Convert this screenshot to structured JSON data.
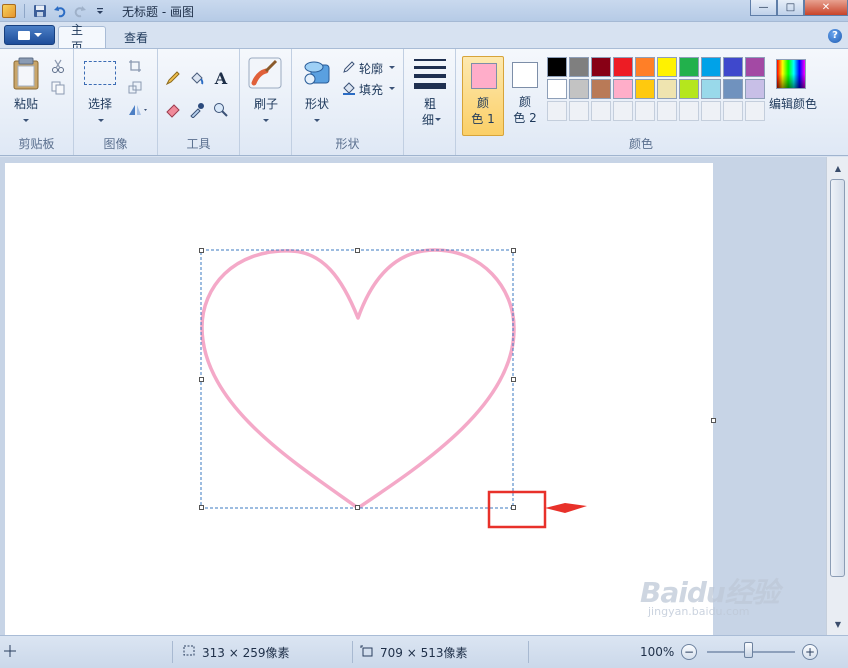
{
  "window": {
    "title": "无标题 - 画图",
    "controls": {
      "minimize": "—",
      "maximize": "□",
      "close": "✕"
    }
  },
  "tabs": [
    {
      "label": "主页",
      "active": true
    },
    {
      "label": "查看",
      "active": false
    }
  ],
  "groups": {
    "clipboard": {
      "label": "剪贴板",
      "paste": "粘贴"
    },
    "image": {
      "label": "图像",
      "select": "选择"
    },
    "tools": {
      "label": "工具",
      "text_tool": "A"
    },
    "brushes": {
      "label": "",
      "brush": "刷子"
    },
    "shapes": {
      "label": "形状",
      "shapes_btn": "形状",
      "outline": "轮廓",
      "fill": "填充"
    },
    "size": {
      "line1": "粗",
      "line2": "细"
    },
    "colors": {
      "label": "颜色",
      "color1": {
        "line1": "颜",
        "line2": "色 1",
        "value": "#ffadc9"
      },
      "color2": {
        "line1": "颜",
        "line2": "色 2",
        "value": "#ffffff"
      },
      "edit": "编辑颜色"
    }
  },
  "palette": [
    "#000000",
    "#7f7f7f",
    "#880015",
    "#ed1c24",
    "#ff7f27",
    "#fff200",
    "#22b14c",
    "#00a2e8",
    "#3f48cc",
    "#a349a4",
    "#ffffff",
    "#c3c3c3",
    "#b97a57",
    "#ffaec9",
    "#ffc90e",
    "#efe4b0",
    "#b5e61d",
    "#99d9ea",
    "#7092be",
    "#c8bfe7"
  ],
  "canvas": {
    "shape": "heart",
    "stroke_color": "#f4a9c8"
  },
  "status": {
    "selection_size": "313 × 259像素",
    "canvas_size": "709 × 513像素",
    "zoom": "100%",
    "zoom_minus": "−",
    "zoom_plus": "+"
  },
  "annotation": {
    "color": "#e8312a"
  },
  "watermark": {
    "text": "Baidu经验",
    "sub": "jingyan.baidu.com"
  }
}
